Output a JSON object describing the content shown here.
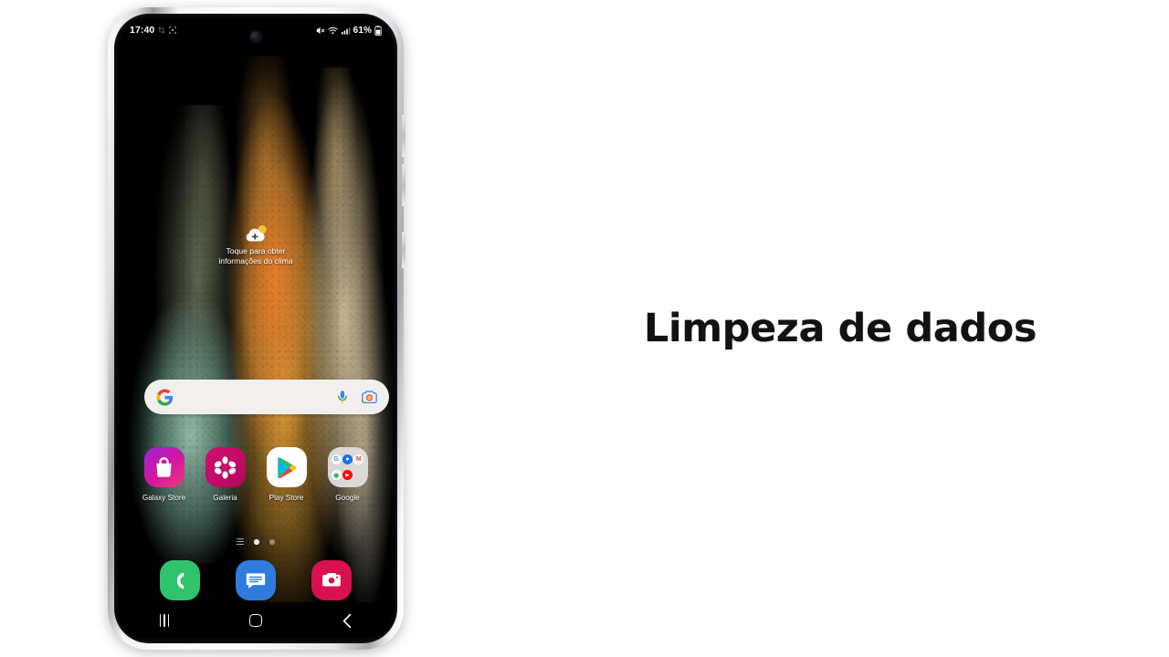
{
  "slide": {
    "title": "Limpeza de dados",
    "background_color": "#ffffff",
    "title_color": "#111214"
  },
  "phone": {
    "device": "Samsung Galaxy S21 Ultra",
    "frame_color": "#e8e8ea",
    "status_bar": {
      "clock": "17:40",
      "notification_icons": [
        "crop-notification-icon",
        "scan-notification-icon"
      ],
      "mute_icon": "mute-icon",
      "wifi_icon": "wifi-icon",
      "signal_icon": "signal-bars-icon",
      "battery_percent": "61%",
      "battery_icon": "battery-icon"
    },
    "weather_widget": {
      "icon": "cloud-plus-icon",
      "line1": "Toque para obter",
      "line2": "informações do clima"
    },
    "search_bar": {
      "google_logo": "google-g-icon",
      "placeholder": "",
      "value": "",
      "mic_icon": "microphone-icon",
      "lens_icon": "google-lens-icon"
    },
    "apps": [
      {
        "name": "galaxy-store",
        "label": "Galaxy Store",
        "icon": "shopping-bag-icon",
        "color": "#d4179e"
      },
      {
        "name": "galeria",
        "label": "Galeria",
        "icon": "flower-icon",
        "color": "#cf1070"
      },
      {
        "name": "play-store",
        "label": "Play Store",
        "icon": "play-triangle-icon",
        "color": "#ffffff"
      },
      {
        "name": "google-folder",
        "label": "Google",
        "icon": "app-folder-icon",
        "color": "#e2e2e2"
      }
    ],
    "google_folder_apps": [
      {
        "name": "google",
        "glyph": "G",
        "color": "#4285f4"
      },
      {
        "name": "chrome",
        "glyph": "●",
        "color": "#1a73e8"
      },
      {
        "name": "gmail",
        "glyph": "M",
        "color": "#ea4335"
      },
      {
        "name": "maps",
        "glyph": "◉",
        "color": "#34a853"
      },
      {
        "name": "youtube",
        "glyph": "▶",
        "color": "#ff0000"
      }
    ],
    "page_indicator": {
      "pages": [
        "list-page-icon",
        "active-dot",
        "inactive-dot"
      ],
      "current": 1
    },
    "dock": [
      {
        "name": "phone",
        "icon": "phone-handset-icon",
        "color": "#2fc36b"
      },
      {
        "name": "messages",
        "icon": "message-bubble-icon",
        "color": "#2f7ce0"
      },
      {
        "name": "camera",
        "icon": "camera-icon",
        "color": "#d8114f"
      }
    ],
    "nav_bar": {
      "recents": "recents-icon",
      "home": "home-icon",
      "back": "back-icon"
    }
  }
}
